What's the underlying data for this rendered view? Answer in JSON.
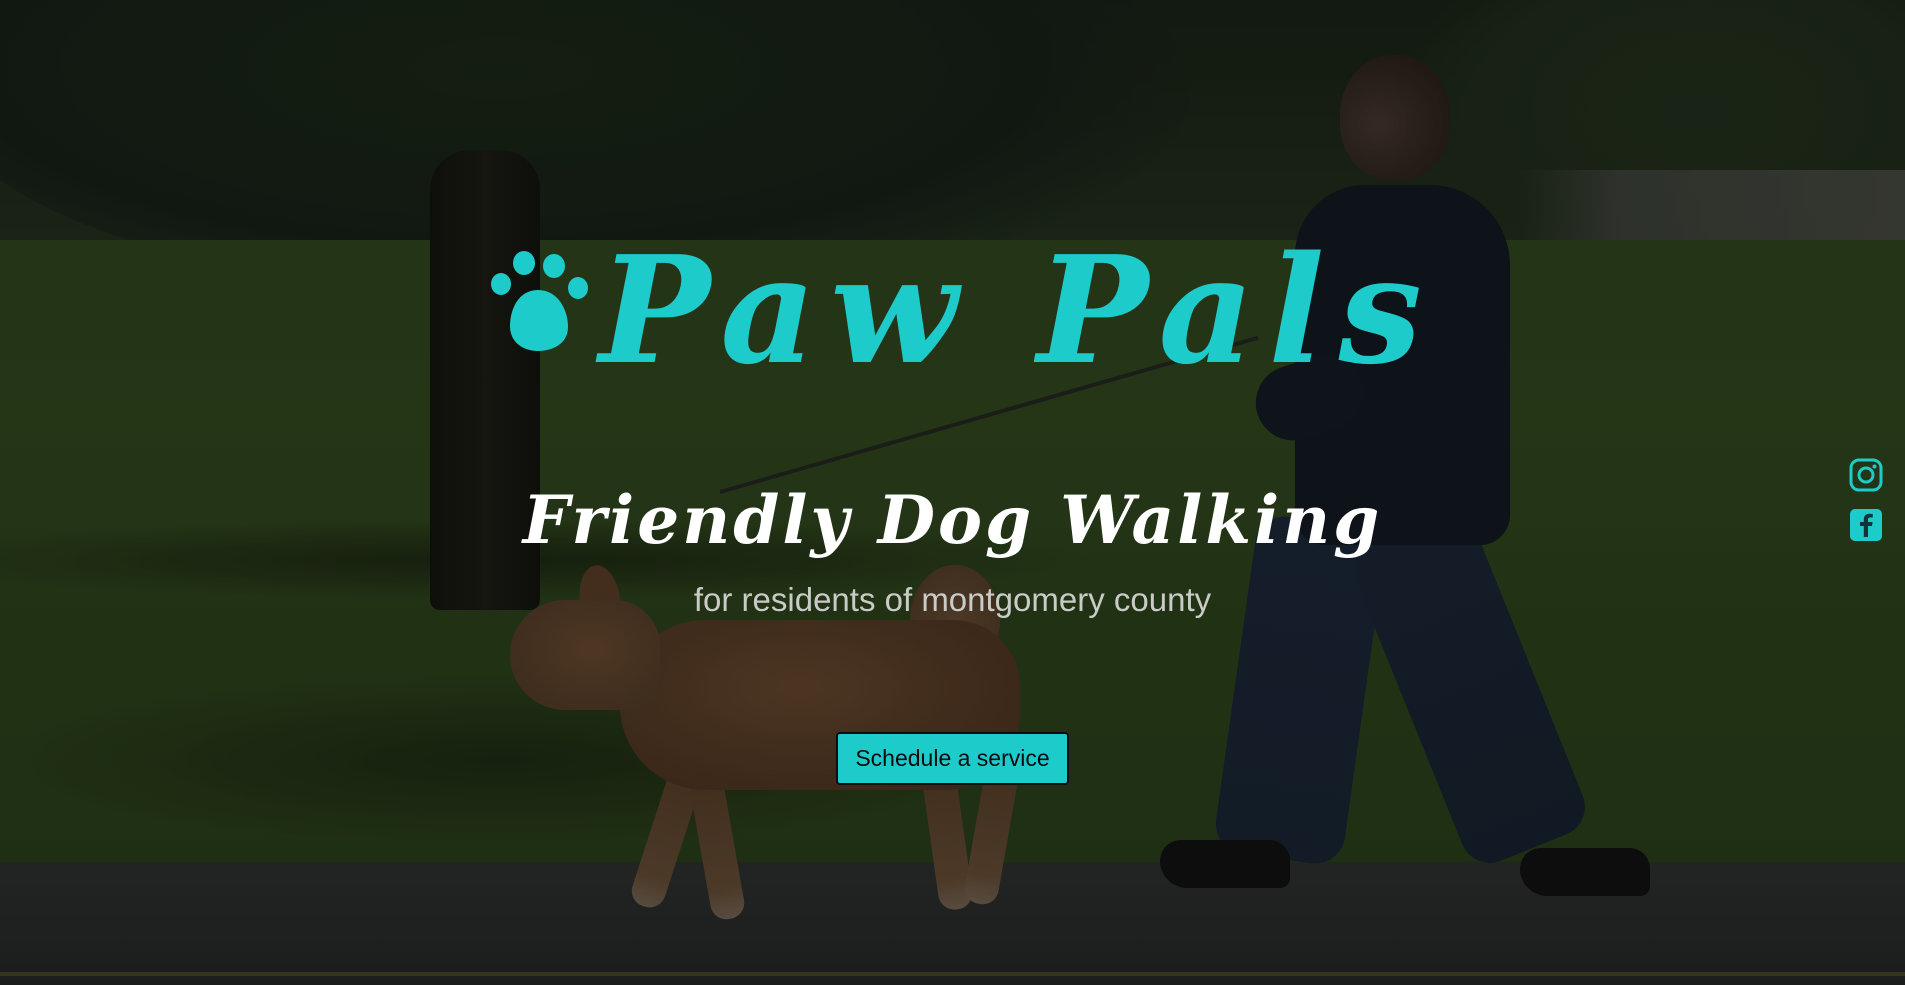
{
  "brand": {
    "name": "Paw Pals",
    "accent_color": "#1ecbcb",
    "logo_icon": "paw-print-icon"
  },
  "hero": {
    "tagline": "Friendly Dog Walking",
    "subtitle": "for residents of montgomery county",
    "cta_label": "Schedule a service",
    "background": "person walking a dog on a park path"
  },
  "social": {
    "items": [
      {
        "icon": "instagram-icon"
      },
      {
        "icon": "facebook-icon"
      }
    ]
  }
}
